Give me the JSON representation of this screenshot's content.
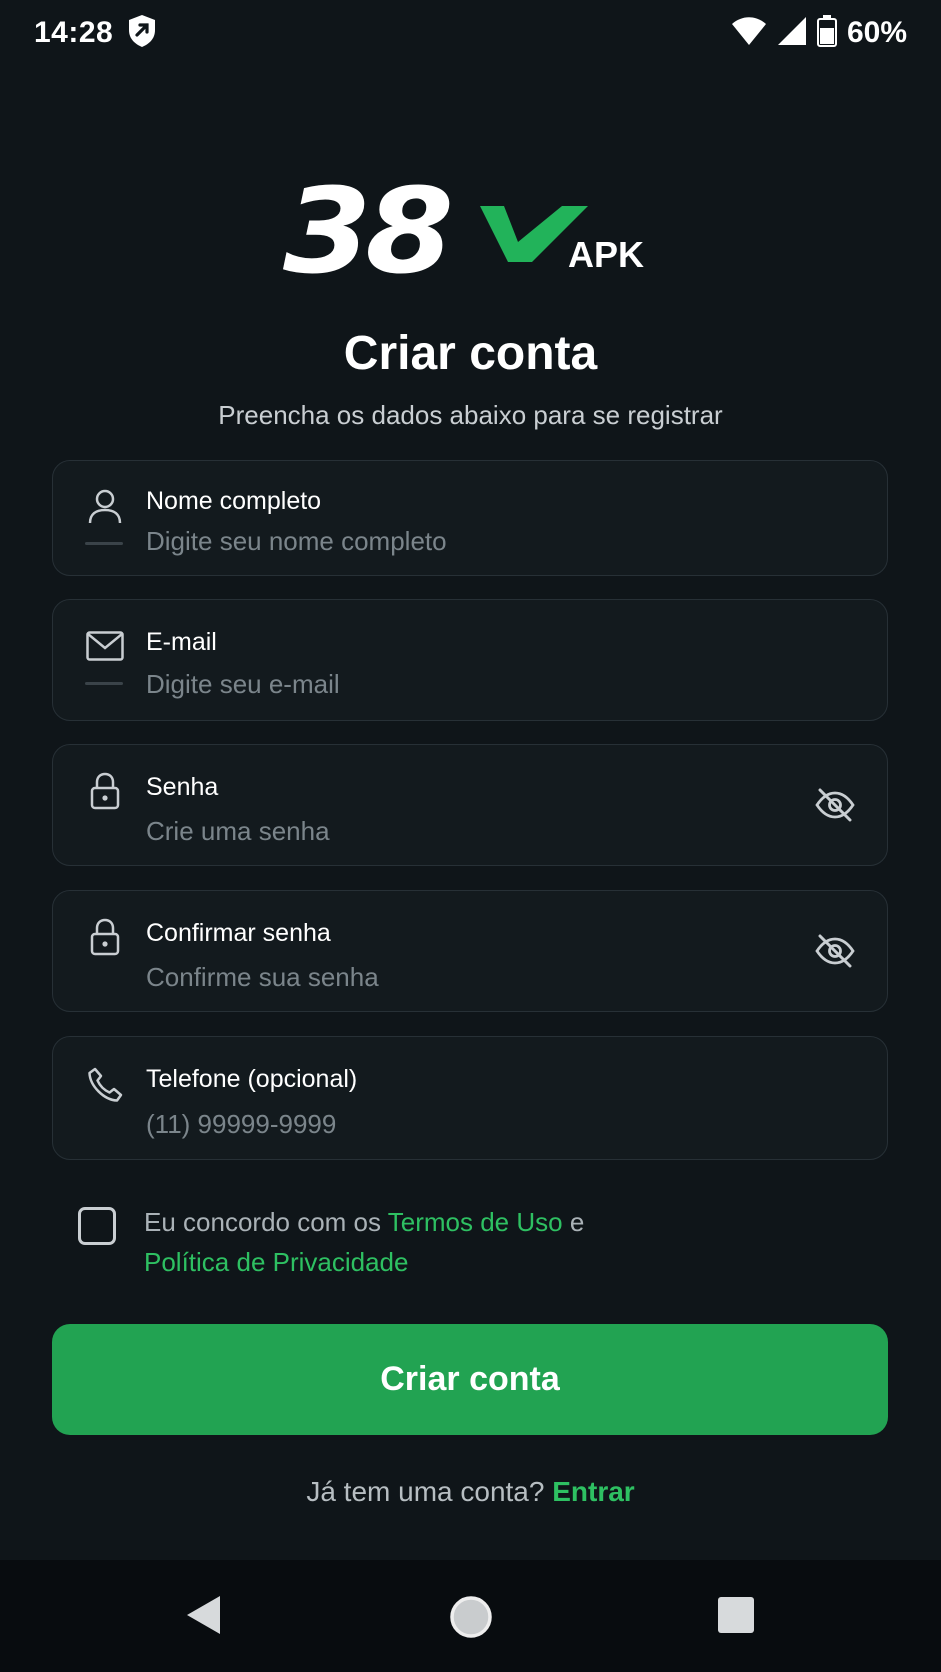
{
  "status_bar": {
    "time": "14:28",
    "battery_text": "60%",
    "icons": [
      "shield-icon",
      "wifi-icon",
      "signal-icon",
      "battery-icon"
    ]
  },
  "logo": {
    "digits": "38",
    "letter": "V",
    "suffix": "APK",
    "accent_color": "#22b35a"
  },
  "header": {
    "title": "Criar conta",
    "subtitle": "Preencha os dados abaixo para se registrar"
  },
  "fields": {
    "name": {
      "label": "Nome completo",
      "placeholder": "Digite seu nome completo",
      "value": "",
      "icon": "user-icon"
    },
    "email": {
      "label": "E-mail",
      "placeholder": "Digite seu e-mail",
      "value": "",
      "icon": "mail-icon"
    },
    "password": {
      "label": "Senha",
      "placeholder": "Crie uma senha",
      "value": "",
      "icon": "lock-icon",
      "toggle_icon": "eye-off-icon"
    },
    "confirm_password": {
      "label": "Confirmar senha",
      "placeholder": "Confirme sua senha",
      "value": "",
      "icon": "lock-icon",
      "toggle_icon": "eye-off-icon"
    },
    "phone": {
      "label": "Telefone (opcional)",
      "placeholder": "(11) 99999-9999",
      "value": "",
      "icon": "phone-icon"
    }
  },
  "terms": {
    "checked": false,
    "prefix": "Eu concordo com os ",
    "terms_link": "Termos de Uso",
    "joiner": " e",
    "privacy_link": "Política de Privacidade"
  },
  "submit": {
    "label": "Criar conta"
  },
  "login": {
    "prompt": "Já tem uma conta? ",
    "link": "Entrar"
  },
  "nav_bar": {
    "buttons": [
      "back-icon",
      "home-icon",
      "recents-icon"
    ]
  },
  "colors": {
    "background": "#0f1519",
    "field_border": "#273036",
    "accent": "#22a352",
    "link": "#2ec062"
  }
}
